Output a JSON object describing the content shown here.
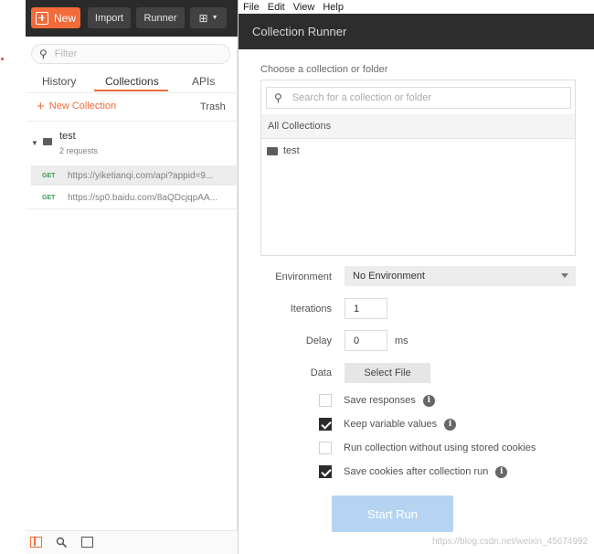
{
  "main": {
    "toolbar": {
      "new_label": "New",
      "import_label": "Import",
      "runner_label": "Runner",
      "more_icon": "new-window-icon"
    },
    "filter_placeholder": "Filter",
    "tabs": [
      {
        "label": "History",
        "active": false
      },
      {
        "label": "Collections",
        "active": true
      },
      {
        "label": "APIs",
        "active": false
      }
    ],
    "new_collection_label": "New Collection",
    "trash_label": "Trash",
    "collection": {
      "name": "test",
      "count": "2 requests",
      "requests": [
        {
          "method": "GET",
          "url": "https://yiketianqi.com/api?appid=9..."
        },
        {
          "method": "GET",
          "url": "https://sp0.baidu.com/8aQDcjqpAA..."
        }
      ]
    },
    "accent_color": "#f26b3a"
  },
  "runner": {
    "menu": [
      "File",
      "Edit",
      "View",
      "Help"
    ],
    "title": "Collection Runner",
    "choose_label": "Choose a collection or folder",
    "search_placeholder": "Search for a collection or folder",
    "all_collections": "All Collections",
    "picker_items": [
      "test"
    ],
    "environment_label": "Environment",
    "environment_value": "No Environment",
    "iterations_label": "Iterations",
    "iterations_value": "1",
    "delay_label": "Delay",
    "delay_value": "0",
    "delay_unit": "ms",
    "data_label": "Data",
    "select_file_label": "Select File",
    "options": [
      {
        "label": "Save responses",
        "checked": false,
        "info": true
      },
      {
        "label": "Keep variable values",
        "checked": true,
        "info": true
      },
      {
        "label": "Run collection without using stored cookies",
        "checked": false,
        "info": false
      },
      {
        "label": "Save cookies after collection run",
        "checked": true,
        "info": true
      }
    ],
    "start_label": "Start Run",
    "watermark": "https://blog.csdn.net/weixin_45674992"
  }
}
